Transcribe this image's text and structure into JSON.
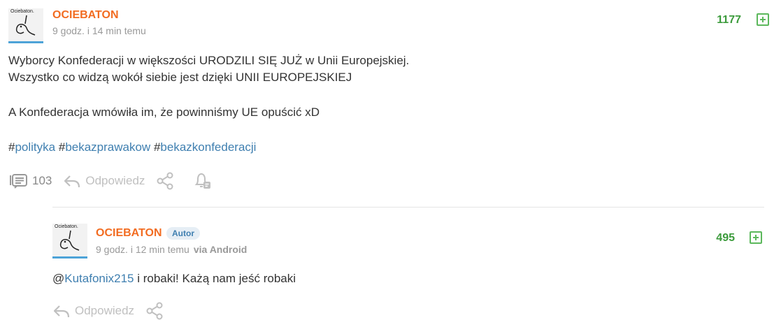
{
  "post": {
    "avatar_caption": "Ociebaton.",
    "author": "OCIEBATON",
    "time": "9 godz. i 14 min temu",
    "score": "1177",
    "lines": [
      "Wyborcy Konfederacji w większości URODZILI SIĘ JUŻ w Unii Europejskiej.",
      "Wszystko co widzą wokół siebie jest dzięki UNII EUROPEJSKIEJ",
      "A Konfederacja wmówiła im, że powinniśmy UE opuścić xD"
    ],
    "tags": [
      "polityka",
      "bekazprawakow",
      "bekazkonfederacji"
    ],
    "tag_prefix": "#",
    "comments_count": "103",
    "reply_label": "Odpowiedz"
  },
  "comment": {
    "avatar_caption": "Ociebaton.",
    "author": "OCIEBATON",
    "badge": "Autor",
    "time": "9 godz. i 12 min temu",
    "via": "via Android",
    "score": "495",
    "mention_prefix": "@",
    "mention": "Kutafonix215",
    "text_rest": " i robaki! Każą nam jeść robaki",
    "reply_label": "Odpowiedz"
  },
  "colors": {
    "author": "#f26c21",
    "score": "#3c9b3c",
    "link": "#3f7fb0",
    "muted": "#999999"
  }
}
